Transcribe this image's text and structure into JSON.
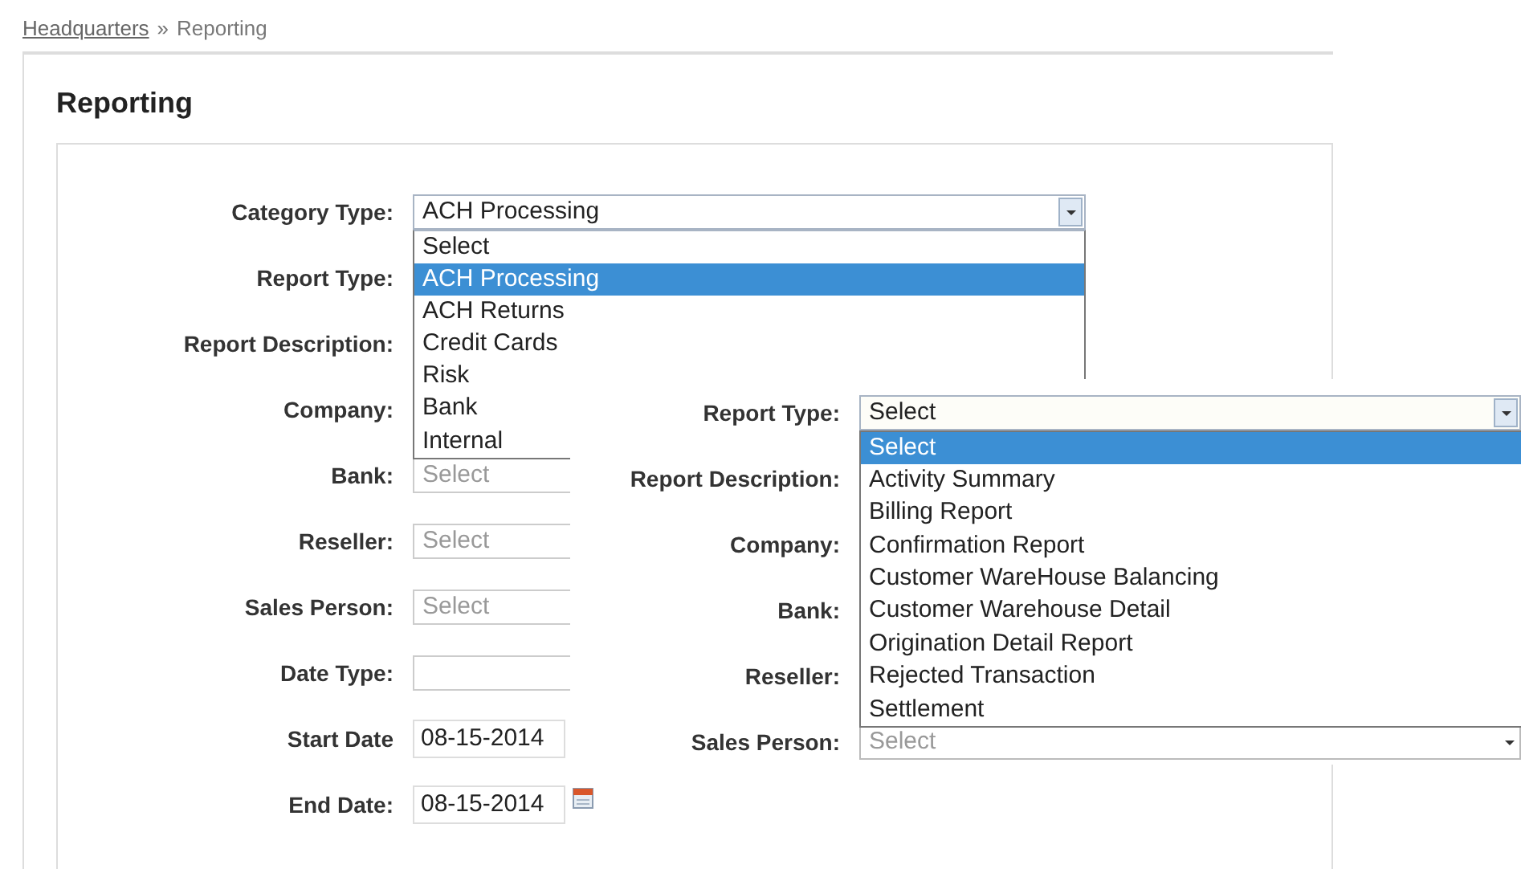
{
  "breadcrumb": {
    "link": "Headquarters",
    "separator": "»",
    "current": "Reporting"
  },
  "title": "Reporting",
  "form": {
    "fields": [
      {
        "label": "Category Type:",
        "kind": "select",
        "value": "ACH Processing",
        "dropdown": {
          "options": [
            {
              "label": "Select",
              "selected": false
            },
            {
              "label": "ACH Processing",
              "selected": true
            },
            {
              "label": "ACH Returns",
              "selected": false
            },
            {
              "label": "Credit Cards",
              "selected": false
            },
            {
              "label": "Risk",
              "selected": false
            },
            {
              "label": "Bank",
              "selected": false
            },
            {
              "label": "Internal",
              "selected": false
            }
          ]
        }
      },
      {
        "label": "Report Type:",
        "kind": "covered"
      },
      {
        "label": "Report Description:",
        "kind": "covered"
      },
      {
        "label": "Company:",
        "kind": "covered"
      },
      {
        "label": "Bank:",
        "kind": "partial",
        "placeholder": "Select"
      },
      {
        "label": "Reseller:",
        "kind": "partial",
        "placeholder": "Select"
      },
      {
        "label": "Sales Person:",
        "kind": "partial",
        "placeholder": "Select"
      },
      {
        "label": "Date Type:",
        "kind": "partial"
      },
      {
        "label": "Start Date",
        "kind": "date",
        "value": "08-15-2014"
      },
      {
        "label": "End Date:",
        "kind": "date",
        "value": "08-15-2014",
        "calendar": true
      }
    ]
  },
  "detail_form": {
    "fields": [
      {
        "label": "Report Type:",
        "kind": "select",
        "value": "Select",
        "dropdown": {
          "options": [
            {
              "label": "Select",
              "selected": true
            },
            {
              "label": "Activity Summary",
              "selected": false
            },
            {
              "label": "Billing Report",
              "selected": false
            },
            {
              "label": "Confirmation Report",
              "selected": false
            },
            {
              "label": "Customer WareHouse Balancing",
              "selected": false
            },
            {
              "label": "Customer Warehouse Detail",
              "selected": false
            },
            {
              "label": "Origination Detail Report",
              "selected": false
            },
            {
              "label": "Rejected Transaction",
              "selected": false
            },
            {
              "label": "Settlement",
              "selected": false
            }
          ]
        }
      },
      {
        "label": "Report Description:",
        "kind": "covered"
      },
      {
        "label": "Company:",
        "kind": "covered"
      },
      {
        "label": "Bank:",
        "kind": "covered"
      },
      {
        "label": "Reseller:",
        "kind": "covered"
      },
      {
        "label": "Sales Person:",
        "kind": "placeholder_select",
        "placeholder": "Select"
      }
    ]
  }
}
